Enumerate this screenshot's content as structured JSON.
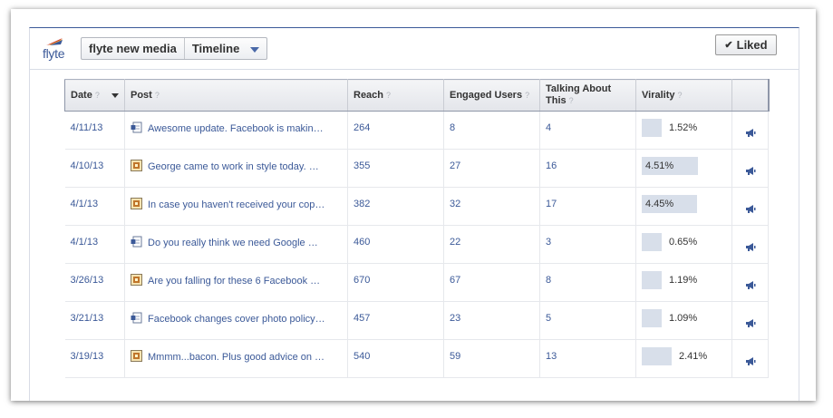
{
  "header": {
    "logo_text": "flyte",
    "page_name": "flyte new media",
    "view_select": "Timeline",
    "liked_label": "Liked",
    "colors": {
      "accent": "#3b5998",
      "bar": "#d8dfea"
    }
  },
  "table": {
    "columns": [
      {
        "key": "date",
        "label": "Date",
        "help": "?"
      },
      {
        "key": "post",
        "label": "Post",
        "help": "?"
      },
      {
        "key": "reach",
        "label": "Reach",
        "help": "?"
      },
      {
        "key": "engaged",
        "label": "Engaged Users",
        "help": "?"
      },
      {
        "key": "talking",
        "label": "Talking About This",
        "help": "?"
      },
      {
        "key": "virality",
        "label": "Virality",
        "help": "?"
      }
    ],
    "rows": [
      {
        "date": "4/11/13",
        "post": "Awesome update. Facebook is makin…",
        "post_icon": "status-icon",
        "reach": "264",
        "engaged": "8",
        "talking": "4",
        "virality": "1.52%",
        "virality_value": 1.52
      },
      {
        "date": "4/10/13",
        "post": "George came to work in style today. …",
        "post_icon": "photo-icon",
        "reach": "355",
        "engaged": "27",
        "talking": "16",
        "virality": "4.51%",
        "virality_value": 4.51
      },
      {
        "date": "4/1/13",
        "post": "In case you haven't received your cop…",
        "post_icon": "photo-icon",
        "reach": "382",
        "engaged": "32",
        "talking": "17",
        "virality": "4.45%",
        "virality_value": 4.45
      },
      {
        "date": "4/1/13",
        "post": "Do you really think we need Google …",
        "post_icon": "status-icon",
        "reach": "460",
        "engaged": "22",
        "talking": "3",
        "virality": "0.65%",
        "virality_value": 0.65
      },
      {
        "date": "3/26/13",
        "post": "Are you falling for these 6 Facebook …",
        "post_icon": "photo-icon",
        "reach": "670",
        "engaged": "67",
        "talking": "8",
        "virality": "1.19%",
        "virality_value": 1.19
      },
      {
        "date": "3/21/13",
        "post": "Facebook changes cover photo policy…",
        "post_icon": "status-icon",
        "reach": "457",
        "engaged": "23",
        "talking": "5",
        "virality": "1.09%",
        "virality_value": 1.09
      },
      {
        "date": "3/19/13",
        "post": "Mmmm...bacon. Plus good advice on …",
        "post_icon": "photo-icon",
        "reach": "540",
        "engaged": "59",
        "talking": "13",
        "virality": "2.41%",
        "virality_value": 2.41
      }
    ]
  }
}
